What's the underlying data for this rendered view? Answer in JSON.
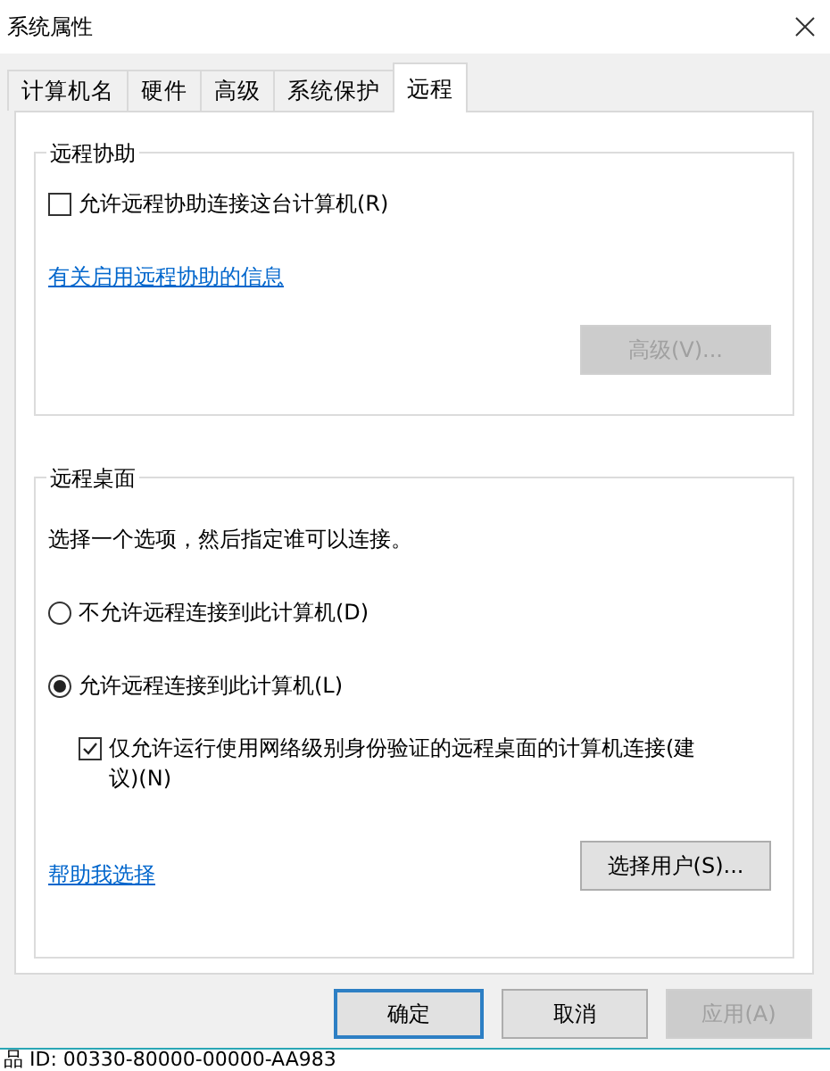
{
  "window": {
    "title": "系统属性"
  },
  "tabs": [
    {
      "label": "计算机名",
      "selected": false
    },
    {
      "label": "硬件",
      "selected": false
    },
    {
      "label": "高级",
      "selected": false
    },
    {
      "label": "系统保护",
      "selected": false
    },
    {
      "label": "远程",
      "selected": true
    }
  ],
  "remote_assistance": {
    "title": "远程协助",
    "allow": {
      "label": "允许远程协助连接这台计算机(R)",
      "checked": false
    },
    "link": "有关启用远程协助的信息",
    "advanced_button": {
      "label": "高级(V)...",
      "disabled": true
    }
  },
  "remote_desktop": {
    "title": "远程桌面",
    "intro": "选择一个选项，然后指定谁可以连接。",
    "options": [
      {
        "label": "不允许远程连接到此计算机(D)",
        "selected": false
      },
      {
        "label": "允许远程连接到此计算机(L)",
        "selected": true
      }
    ],
    "nla": {
      "label": "仅允许运行使用网络级别身份验证的远程桌面的计算机连接(建议)(N)",
      "checked": true
    },
    "help_link": "帮助我选择",
    "select_users_button": {
      "label": "选择用户(S)...",
      "disabled": false
    }
  },
  "buttons": [
    {
      "label": "确定",
      "default": true,
      "disabled": false
    },
    {
      "label": "取消",
      "default": false,
      "disabled": false
    },
    {
      "label": "应用(A)",
      "default": false,
      "disabled": true
    }
  ],
  "background_text": "品 ID: 00330-80000-00000-AA983"
}
